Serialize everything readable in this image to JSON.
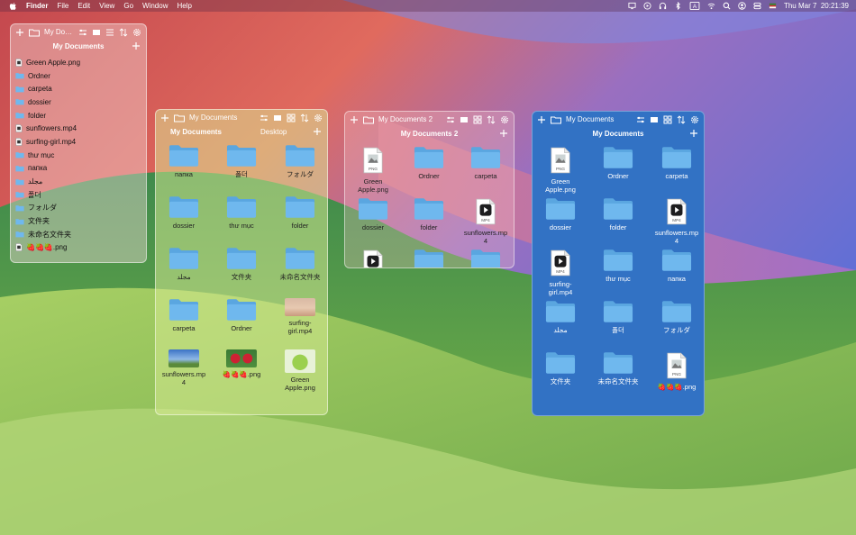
{
  "menubar": {
    "app_name": "Finder",
    "menus": [
      "File",
      "Edit",
      "View",
      "Go",
      "Window",
      "Help"
    ],
    "status_icons": [
      "display-icon",
      "play-circle-icon",
      "headphones-icon",
      "bluetooth-icon",
      "keyboard-input-icon",
      "wifi-icon",
      "search-icon",
      "user-icon",
      "control-center-icon",
      "flag-icon"
    ],
    "input_indicator": "A",
    "clock": "Thu Mar 7  20:21:39"
  },
  "window1": {
    "title": "My Doc...",
    "subtitle": "My Documents",
    "items": [
      {
        "name": "Green Apple.png",
        "kind": "file"
      },
      {
        "name": "Ordner",
        "kind": "folder"
      },
      {
        "name": "carpeta",
        "kind": "folder"
      },
      {
        "name": "dossier",
        "kind": "folder"
      },
      {
        "name": "folder",
        "kind": "folder"
      },
      {
        "name": "sunflowers.mp4",
        "kind": "file"
      },
      {
        "name": "surfing-girl.mp4",
        "kind": "file"
      },
      {
        "name": "thư mục",
        "kind": "folder"
      },
      {
        "name": "папка",
        "kind": "folder"
      },
      {
        "name": "مجلد",
        "kind": "folder"
      },
      {
        "name": "폴더",
        "kind": "folder"
      },
      {
        "name": "フォルダ",
        "kind": "folder"
      },
      {
        "name": "文件夹",
        "kind": "folder"
      },
      {
        "name": "未命名文件夹",
        "kind": "folder"
      },
      {
        "name": "🍓🍓🍓.png",
        "kind": "file"
      }
    ]
  },
  "window2": {
    "title": "My Documents",
    "tab_left": "My Documents",
    "tab_right": "Desktop",
    "items": [
      {
        "name": "папка",
        "kind": "folder"
      },
      {
        "name": "폴더",
        "kind": "folder"
      },
      {
        "name": "フォルダ",
        "kind": "folder"
      },
      {
        "name": "dossier",
        "kind": "folder"
      },
      {
        "name": "thư mục",
        "kind": "folder"
      },
      {
        "name": "folder",
        "kind": "folder"
      },
      {
        "name": "مجلد",
        "kind": "folder"
      },
      {
        "name": "文件夹",
        "kind": "folder"
      },
      {
        "name": "未命名文件夹",
        "kind": "folder"
      },
      {
        "name": "carpeta",
        "kind": "folder"
      },
      {
        "name": "Ordner",
        "kind": "folder"
      },
      {
        "name": "surfing-\ngirl.mp4",
        "kind": "photo-surf"
      },
      {
        "name": "sunflowers.mp\n4",
        "kind": "photo-sky"
      },
      {
        "name": "🍓🍓🍓.png",
        "kind": "photo-berry"
      },
      {
        "name": "Green\nApple.png",
        "kind": "photo-apple"
      }
    ]
  },
  "window3": {
    "title": "My Documents 2",
    "subtitle": "My Documents 2",
    "items": [
      {
        "name": "Green\nApple.png",
        "kind": "png"
      },
      {
        "name": "Ordner",
        "kind": "folder"
      },
      {
        "name": "carpeta",
        "kind": "folder"
      },
      {
        "name": "dossier",
        "kind": "folder"
      },
      {
        "name": "folder",
        "kind": "folder"
      },
      {
        "name": "sunflowers.mp\n4",
        "kind": "mp4"
      },
      {
        "name": "",
        "kind": "mp4"
      },
      {
        "name": "",
        "kind": "folder"
      },
      {
        "name": "",
        "kind": "folder"
      }
    ]
  },
  "window4": {
    "title": "My Documents",
    "subtitle": "My Documents",
    "items": [
      {
        "name": "Green\nApple.png",
        "kind": "png"
      },
      {
        "name": "Ordner",
        "kind": "folder"
      },
      {
        "name": "carpeta",
        "kind": "folder"
      },
      {
        "name": "dossier",
        "kind": "folder"
      },
      {
        "name": "folder",
        "kind": "folder"
      },
      {
        "name": "sunflowers.mp\n4",
        "kind": "mp4"
      },
      {
        "name": "surfing-\ngirl.mp4",
        "kind": "mp4"
      },
      {
        "name": "thư mục",
        "kind": "folder"
      },
      {
        "name": "папка",
        "kind": "folder"
      },
      {
        "name": "مجلد",
        "kind": "folder"
      },
      {
        "name": "폴더",
        "kind": "folder"
      },
      {
        "name": "フォルダ",
        "kind": "folder"
      },
      {
        "name": "文件夹",
        "kind": "folder"
      },
      {
        "name": "未命名文件夹",
        "kind": "folder"
      },
      {
        "name": "🍓🍓🍓.png",
        "kind": "png"
      }
    ]
  },
  "file_badges": {
    "png": "PNG",
    "mp4": "MP4"
  },
  "colors": {
    "folder_fill": "#6fb8ee",
    "folder_tab": "#5aa6e0",
    "accent_blue_window": "#2d6fc8"
  }
}
